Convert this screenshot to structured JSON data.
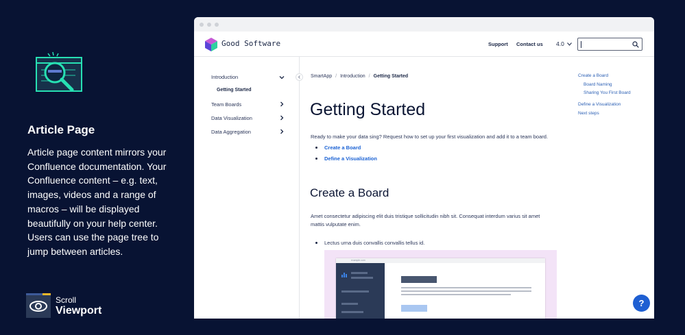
{
  "promo": {
    "title": "Article Page",
    "body": "Article page content mirrors your Confluence documentation. Your Confluence content – e.g. text, images, videos and a range of macros – will be displayed beautifully on your help center. Users can use the page tree to jump between articles."
  },
  "brand": {
    "line1": "Scroll",
    "line2": "Viewport"
  },
  "site": {
    "name": "Good Software",
    "nav": [
      "Support",
      "Contact us"
    ],
    "version": "4.0",
    "search_value": ""
  },
  "left_nav": {
    "items": [
      "Introduction",
      "Team Boards",
      "Data Visualization",
      "Data Aggregation"
    ],
    "active_sub": "Getting Started"
  },
  "breadcrumb": [
    "SmartApp",
    "Introduction",
    "Getting Started"
  ],
  "article": {
    "title": "Getting Started",
    "intro": "Ready to make your data sing? Request how to set up your first visualization and add it to a team board.",
    "toc": [
      "Create a Board",
      "Define a Visualization"
    ],
    "section_title": "Create a Board",
    "paragraph": "Amet consectetur adipiscing elit duis tristique sollicitudin nibh sit. Consequat interdum varius sit amet mattis vulputate enim.",
    "list_item": "Lectus urna duis convallis convallis tellus id.",
    "figure_url": "example.com"
  },
  "right_toc": [
    "Create a Board",
    "Board Naming",
    "Sharing You First Board",
    "Define a Visualization",
    "Next steps"
  ],
  "help_label": "?",
  "colors": {
    "background": "#081333",
    "link": "#1b62d4",
    "accent": "#1f5fd2",
    "icon": "#27e0b3"
  }
}
